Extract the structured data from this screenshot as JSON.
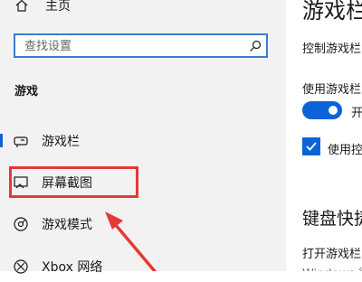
{
  "sidebar": {
    "home_label": "主页",
    "search_placeholder": "查找设置",
    "section_title": "游戏",
    "items": [
      {
        "label": "游戏栏",
        "icon": "game-bar-icon",
        "selected": true
      },
      {
        "label": "屏幕截图",
        "icon": "screenshot-icon",
        "selected": false
      },
      {
        "label": "游戏模式",
        "icon": "game-mode-icon",
        "selected": false
      },
      {
        "label": "Xbox 网络",
        "icon": "xbox-icon",
        "selected": false
      }
    ]
  },
  "main": {
    "title": "游戏栏",
    "desc1": "控制游戏栏",
    "desc2": "使用游戏栏",
    "toggle_label": "开",
    "checkbox_label": "使用控",
    "heading2": "键盘快捷",
    "desc3": "打开游戏栏",
    "desc4": "Windows 徽"
  },
  "annotation": {
    "color": "#e53935"
  },
  "colors": {
    "accent": "#0a64d8",
    "sidebar_bg": "#f2f2f2",
    "search_border": "#3a7bd5"
  }
}
